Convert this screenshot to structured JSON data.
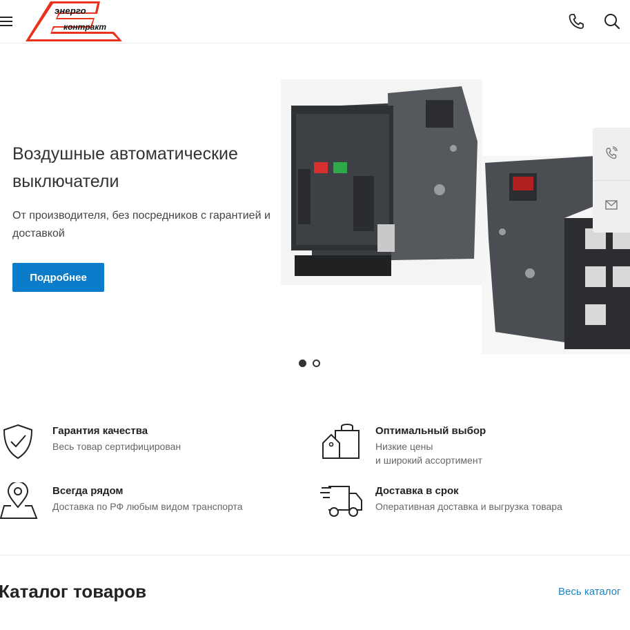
{
  "header": {
    "logo_line1": "энерго",
    "logo_line2": "контракт",
    "logo_color": "#e8321e"
  },
  "hero": {
    "title": "Воздушные автоматические выключатели",
    "subtitle": "От производителя, без посредников с гарантией и доставкой",
    "button_label": "Подробнее",
    "accent_color": "#0b7cc9",
    "slides_total": 2,
    "slide_active": 1
  },
  "features": [
    {
      "icon": "shield-check-icon",
      "title": "Гарантия качества",
      "desc": [
        "Весь товар сертифицирован"
      ]
    },
    {
      "icon": "shopping-bag-tag-icon",
      "title": "Оптимальный выбор",
      "desc": [
        "Низкие цены",
        "и широкий ассортимент"
      ]
    },
    {
      "icon": "map-pin-icon",
      "title": "Всегда рядом",
      "desc": [
        "Доставка по РФ любым видом транспорта"
      ]
    },
    {
      "icon": "delivery-truck-icon",
      "title": "Доставка в срок",
      "desc": [
        "Оперативная доставка и выгрузка товара"
      ]
    }
  ],
  "catalog": {
    "title": "Каталог товаров",
    "link": "Весь каталог"
  }
}
